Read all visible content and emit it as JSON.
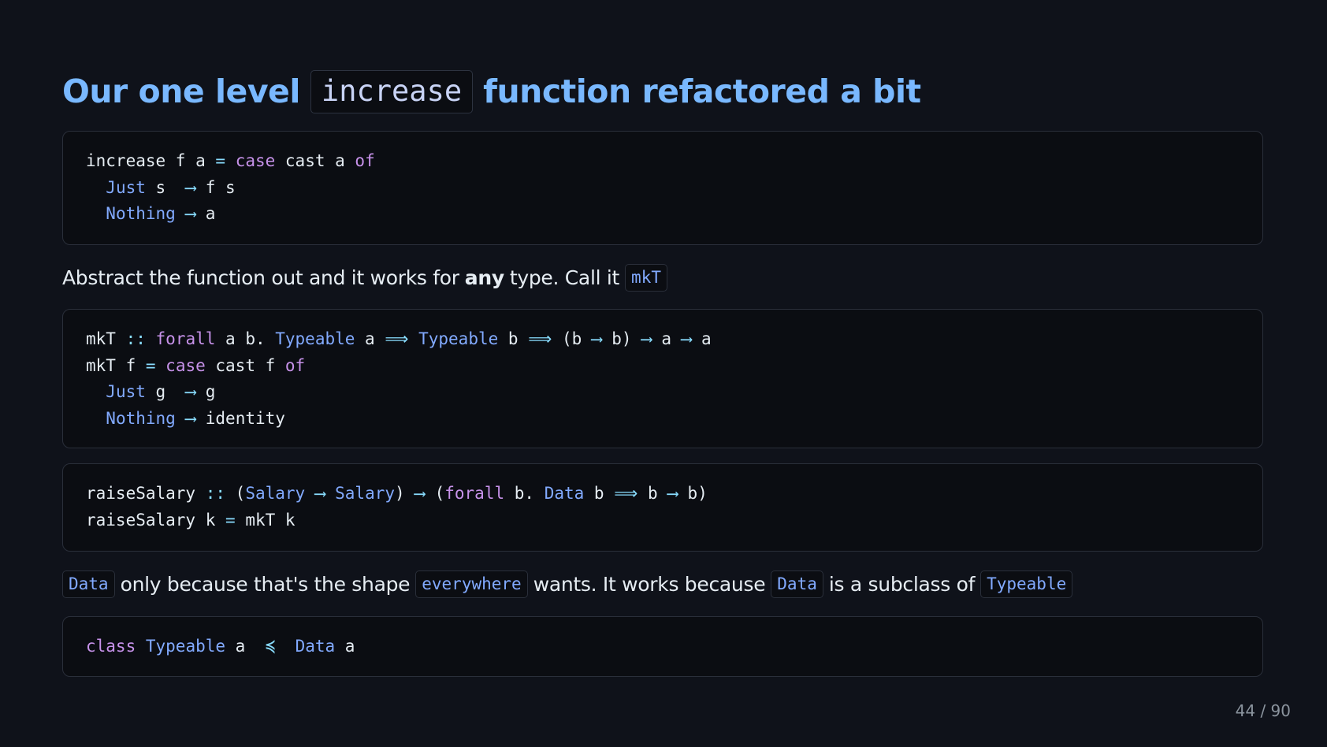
{
  "title": {
    "before": "Our one level",
    "code": "increase",
    "after": "function refactored a bit"
  },
  "code1": {
    "l1": {
      "a": "increase f a ",
      "b": "=",
      "c": " ",
      "d": "case",
      "e": " cast a ",
      "f": "of"
    },
    "l2": {
      "a": "  ",
      "b": "Just",
      "c": " s  ",
      "d": "⟶",
      "e": " f s"
    },
    "l3": {
      "a": "  ",
      "b": "Nothing",
      "c": " ",
      "d": "⟶",
      "e": " a"
    }
  },
  "prose1": {
    "before": "Abstract the function out and it works for",
    "bold": "any",
    "after": "type. Call it",
    "code": "mkT"
  },
  "code2": {
    "l1": {
      "a": "mkT ",
      "b": "::",
      "c": " ",
      "d": "forall",
      "e": " a b. ",
      "f": "Typeable",
      "g": " a ",
      "h": "⟹",
      "i": " ",
      "j": "Typeable",
      "k": " b ",
      "l": "⟹",
      "m": " (b ",
      "n": "⟶",
      "o": " b) ",
      "p": "⟶",
      "q": " a ",
      "r": "⟶",
      "s": " a"
    },
    "l2": {
      "a": "mkT f ",
      "b": "=",
      "c": " ",
      "d": "case",
      "e": " cast f ",
      "f": "of"
    },
    "l3": {
      "a": "  ",
      "b": "Just",
      "c": " g  ",
      "d": "⟶",
      "e": " g"
    },
    "l4": {
      "a": "  ",
      "b": "Nothing",
      "c": " ",
      "d": "⟶",
      "e": " identity"
    }
  },
  "code3": {
    "l1": {
      "a": "raiseSalary ",
      "b": "::",
      "c": " (",
      "d": "Salary",
      "e": " ",
      "f": "⟶",
      "g": " ",
      "h": "Salary",
      "i": ") ",
      "j": "⟶",
      "k": " (",
      "l": "forall",
      "m": " b. ",
      "n": "Data",
      "o": " b ",
      "p": "⟹",
      "q": " b ",
      "r": "⟶",
      "s": " b)"
    },
    "l2": {
      "a": "raiseSalary k ",
      "b": "=",
      "c": " mkT k"
    }
  },
  "prose2": {
    "code1": "Data",
    "t1": "only because that's the shape",
    "code2": "everywhere",
    "t2": "wants. It works because",
    "code3": "Data",
    "t3": "is a subclass of",
    "code4": "Typeable"
  },
  "code4": {
    "l1": {
      "a": "class",
      "b": " ",
      "c": "Typeable",
      "d": " a  ",
      "e": "≼",
      "f": "  ",
      "g": "Data",
      "h": " a"
    }
  },
  "page": "44 / 90"
}
